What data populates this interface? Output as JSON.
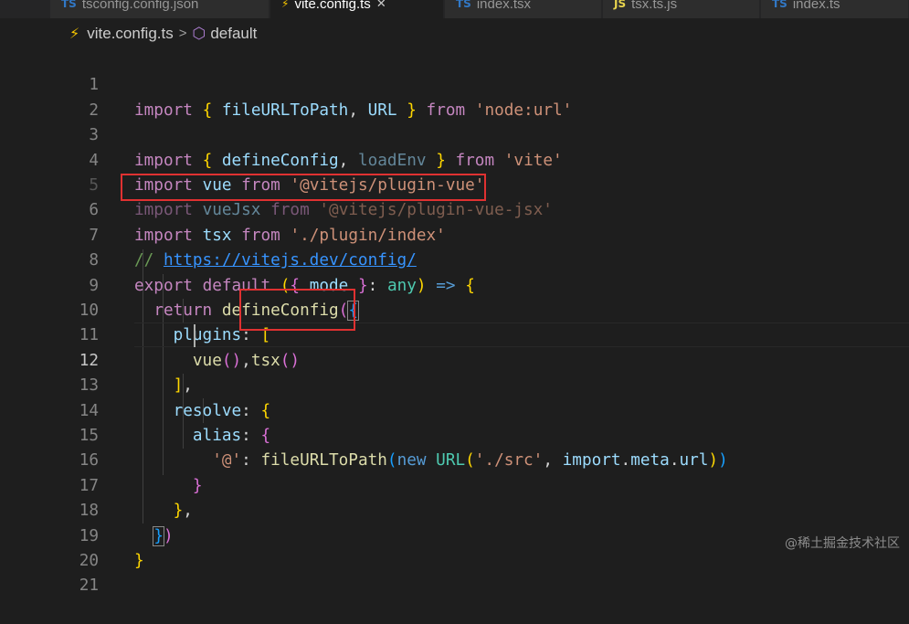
{
  "tabs": [
    {
      "label": "tsconfig.config.json",
      "icon": "ts-icon",
      "glyph": "TS",
      "active": false
    },
    {
      "label": "vite.config.ts",
      "icon": "vite-icon",
      "glyph": "⚡",
      "active": true,
      "close": "✕"
    },
    {
      "label": "index.tsx",
      "icon": "ts-icon",
      "glyph": "TS",
      "active": false
    },
    {
      "label": "tsx.ts.js",
      "icon": "js-icon",
      "glyph": "JS",
      "active": false
    },
    {
      "label": "index.ts",
      "icon": "ts-icon",
      "glyph": "TS",
      "active": false
    }
  ],
  "breadcrumb": {
    "file": "vite.config.ts",
    "file_icon": "⚡",
    "separator": ">",
    "symbol_icon": "⬡",
    "symbol": "default"
  },
  "editor": {
    "current_line": 12,
    "lines": [
      {
        "n": "1"
      },
      {
        "n": "2"
      },
      {
        "n": "3"
      },
      {
        "n": "4"
      },
      {
        "n": "5"
      },
      {
        "n": "6"
      },
      {
        "n": "7"
      },
      {
        "n": "8"
      },
      {
        "n": "9"
      },
      {
        "n": "10"
      },
      {
        "n": "11"
      },
      {
        "n": "12"
      },
      {
        "n": "13"
      },
      {
        "n": "14"
      },
      {
        "n": "15"
      },
      {
        "n": "16"
      },
      {
        "n": "17"
      },
      {
        "n": "18"
      },
      {
        "n": "19"
      },
      {
        "n": "20"
      },
      {
        "n": "21"
      }
    ],
    "tokens": {
      "import": "import",
      "from": "from",
      "export": "export",
      "default": "default",
      "return": "return",
      "new": "new",
      "any": "any",
      "arrow": "=>",
      "fileURLToPath": "fileURLToPath",
      "URL": "URL",
      "defineConfig": "defineConfig",
      "loadEnv": "loadEnv",
      "vue": "vue",
      "vueJsx": "vueJsx",
      "tsx": "tsx",
      "mode": "mode",
      "plugins": "plugins",
      "resolve": "resolve",
      "alias": "alias",
      "meta": "meta",
      "url": "url",
      "s_node_url": "'node:url'",
      "s_vite": "'vite'",
      "s_plugin_vue": "'@vitejs/plugin-vue'",
      "s_plugin_vue_jsx": "'@vitejs/plugin-vue-jsx'",
      "s_plugin_index": "'./plugin/index'",
      "s_at": "'@'",
      "s_src": "'./src'",
      "comment_prefix": "// ",
      "comment_link": "https://vitejs.dev/config/"
    }
  },
  "watermark": "@稀土掘金技术社区"
}
